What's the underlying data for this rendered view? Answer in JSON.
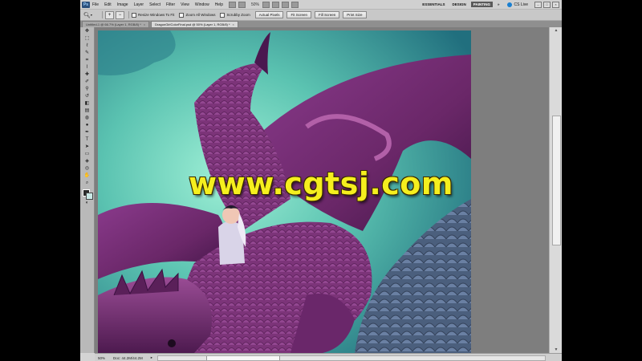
{
  "menubar": {
    "app_icon": "Ps",
    "items": [
      "File",
      "Edit",
      "Image",
      "Layer",
      "Select",
      "Filter",
      "View",
      "Window",
      "Help"
    ],
    "zoom_value": "50%",
    "workspaces": [
      "ESSENTIALS",
      "DESIGN",
      "PAINTING"
    ],
    "active_workspace": "PAINTING",
    "cs_live": "CS Live"
  },
  "options_bar": {
    "resize_windows": "Resize Windows To Fit",
    "zoom_all_windows": "Zoom All Windows",
    "scrubby_zoom": "Scrubby Zoom",
    "actual_pixels": "Actual Pixels",
    "fit_screen": "Fit Screen",
    "fill_screen": "Fill Screen",
    "print_size": "Print Size"
  },
  "tabs": [
    {
      "label": "Untitled-1 @ 66.7% (Layer 1, RGB/8) *"
    },
    {
      "label": "DragonGirlColorFinal.psd @ 50% (Layer 1, RGB/8) *"
    }
  ],
  "status": {
    "zoom": "50%",
    "doc": "Doc: 44.2M/44.2M"
  },
  "watermark": "www.cgtsj.com",
  "colors": {
    "foreground": "#2b2b2b",
    "background": "#c9e9e6",
    "watermark": "#f5ef1e",
    "sky": "#5bbfae",
    "dragon": "#7a2f78"
  }
}
